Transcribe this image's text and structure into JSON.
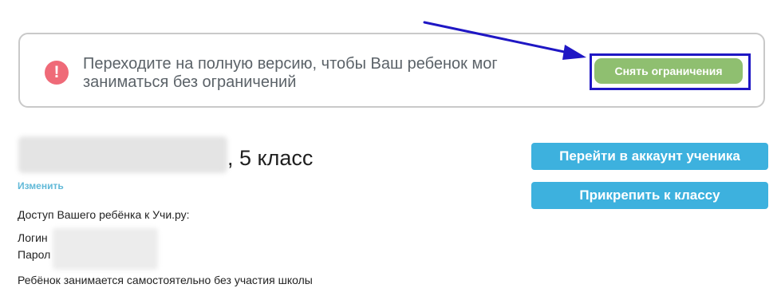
{
  "notice": {
    "icon": "exclamation-icon",
    "icon_glyph": "!",
    "text": "Переходите на полную версию, чтобы Ваш ребенок мог заниматься без ограничений",
    "button_label": "Снять ограничения",
    "accent_color": "#ef6a78",
    "button_color": "#8fbf70",
    "annotation_color": "#1f17c4"
  },
  "student": {
    "class_text": ", 5 класс",
    "edit_label": "Изменить",
    "access_text": "Доступ Вашего ребёнка к Учи.ру:",
    "login_label": "Логин",
    "password_label": "Парол",
    "independent_text": "Ребёнок занимается самостоятельно без участия школы"
  },
  "actions": {
    "student_account_label": "Перейти в аккаунт ученика",
    "attach_class_label": "Прикрепить к классу",
    "button_color": "#3db1de"
  }
}
